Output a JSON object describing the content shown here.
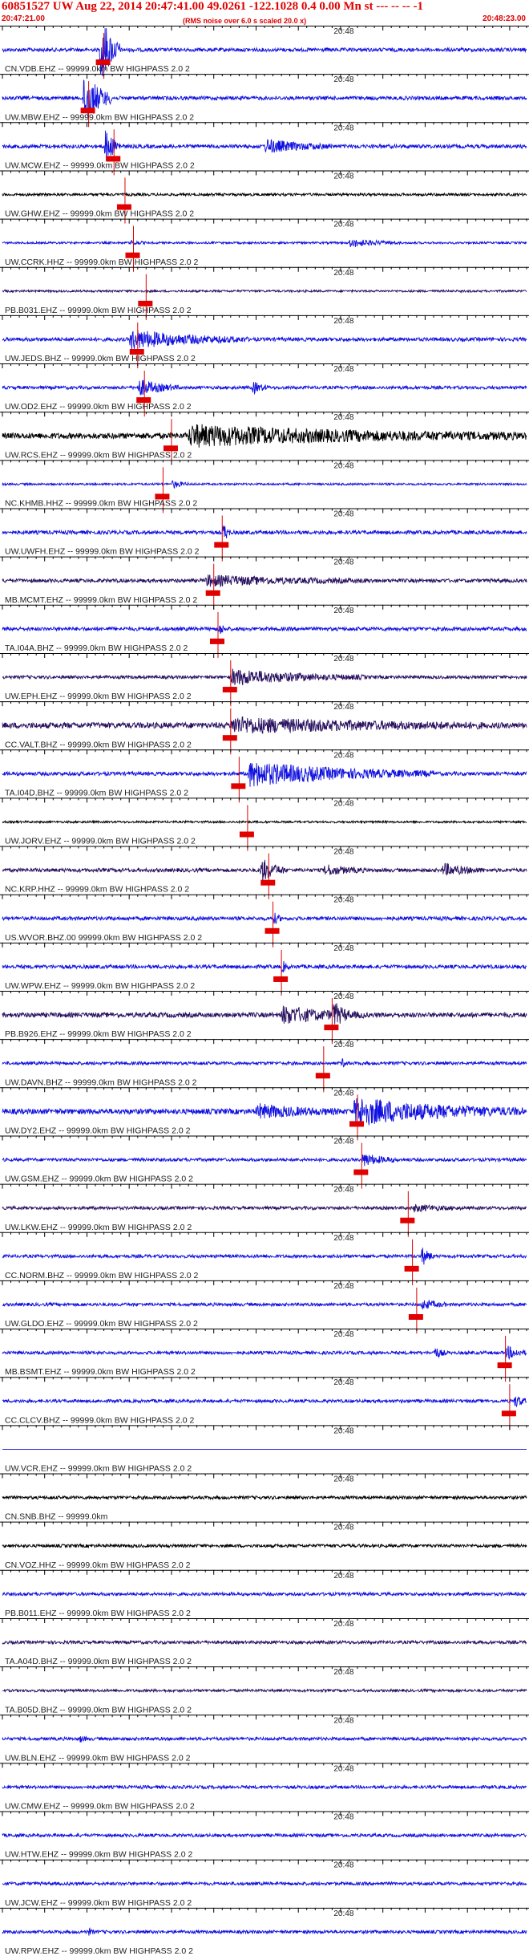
{
  "header": {
    "title": "60851527 UW Aug 22, 2014 20:47:41.00   49.0261 -122.1028  0.4 0.00 Mn st --- -- --   -1",
    "start_time": "20:47:21.00",
    "note": "(RMS noise over 6.0 s scaled 20.0 x)",
    "end_time": "20:48:23.00"
  },
  "chart_data": {
    "type": "line",
    "title": "60851527 UW Aug 22, 2014 20:47:41.00   49.0261 -122.1028  0.4 0.00 Mn st --- -- --   -1",
    "x_start": "20:47:21.00",
    "x_end": "20:48:23.00",
    "time_mark": "20:48",
    "duration_s": 62,
    "colors": {
      "blue": "#1010e0",
      "dark": "#281060",
      "black": "#000000",
      "pick": "#e00000",
      "grid": "#000000"
    },
    "traces": [
      {
        "label": "CN.VDB.EHZ -- 99999.0km BW  HIGHPASS  2.0  2",
        "color": "blue",
        "noise": 0.35,
        "pick": 12.0,
        "events": [
          {
            "t": 11.5,
            "dur": 2.5,
            "amp": 8
          }
        ]
      },
      {
        "label": "UW.MBW.EHZ -- 99999.0km BW  HIGHPASS  2.0  2",
        "color": "blue",
        "noise": 0.35,
        "pick": 10.2,
        "events": [
          {
            "t": 9.5,
            "dur": 3.5,
            "amp": 6
          }
        ]
      },
      {
        "label": "UW.MCW.EHZ -- 99999.0km BW  HIGHPASS  2.0  2",
        "color": "blue",
        "noise": 0.35,
        "pick": 13.2,
        "events": [
          {
            "t": 12.0,
            "dur": 2.0,
            "amp": 4
          },
          {
            "t": 31.0,
            "dur": 8,
            "amp": 1.3
          }
        ]
      },
      {
        "label": "UW.GHW.EHZ -- 99999.0km BW  HIGHPASS  2.0  2",
        "color": "black",
        "noise": 0.25,
        "pick": 14.5,
        "events": []
      },
      {
        "label": "UW.CCRK.HHZ -- 99999.0km BW  HIGHPASS  2.0  2",
        "color": "blue",
        "noise": 0.2,
        "pick": 15.5,
        "events": [
          {
            "t": 15.0,
            "dur": 2,
            "amp": 0.5
          },
          {
            "t": 41.0,
            "dur": 6,
            "amp": 0.8
          }
        ]
      },
      {
        "label": "PB.B031.EHZ -- 99999.0km BW  HIGHPASS  2.0  2",
        "color": "dark",
        "noise": 0.2,
        "pick": 17.0,
        "events": []
      },
      {
        "label": "UW.JEDS.BHZ -- 99999.0km BW  HIGHPASS  2.0  2",
        "color": "blue",
        "noise": 0.35,
        "pick": 16.0,
        "events": [
          {
            "t": 15.0,
            "dur": 14,
            "amp": 1.8
          }
        ]
      },
      {
        "label": "UW.OD2.EHZ -- 99999.0km BW  HIGHPASS  2.0  2",
        "color": "blue",
        "noise": 0.3,
        "pick": 16.8,
        "events": [
          {
            "t": 16.0,
            "dur": 5,
            "amp": 1.6
          },
          {
            "t": 29.5,
            "dur": 2,
            "amp": 1.3
          }
        ]
      },
      {
        "label": "UW.RCS.EHZ -- 99999.0km BW  HIGHPASS  2.0  2",
        "color": "black",
        "noise": 0.55,
        "pick": 20.0,
        "events": [
          {
            "t": 22.0,
            "dur": 40,
            "amp": 1.8
          }
        ]
      },
      {
        "label": "NC.KHMB.HHZ -- 99999.0km BW  HIGHPASS  2.0  2",
        "color": "blue",
        "noise": 0.2,
        "pick": 19.0,
        "events": [
          {
            "t": 20.0,
            "dur": 2,
            "amp": 0.9
          }
        ]
      },
      {
        "label": "UW.UWFH.EHZ -- 99999.0km BW  HIGHPASS  2.0  2",
        "color": "blue",
        "noise": 0.35,
        "pick": 26.0,
        "events": [
          {
            "t": 26.0,
            "dur": 1,
            "amp": 2.5
          }
        ]
      },
      {
        "label": "MB.MCMT.EHZ -- 99999.0km BW  HIGHPASS  2.0  2",
        "color": "dark",
        "noise": 0.35,
        "pick": 25.0,
        "events": [
          {
            "t": 24.0,
            "dur": 20,
            "amp": 0.9
          }
        ]
      },
      {
        "label": "TA.I04A.BHZ -- 99999.0km BW  HIGHPASS  2.0  2",
        "color": "blue",
        "noise": 0.35,
        "pick": 25.5,
        "events": [
          {
            "t": 25.5,
            "dur": 1,
            "amp": 1.5
          }
        ]
      },
      {
        "label": "UW.EPH.EHZ -- 99999.0km BW  HIGHPASS  2.0  2",
        "color": "dark",
        "noise": 0.3,
        "pick": 27.0,
        "events": [
          {
            "t": 27.0,
            "dur": 16,
            "amp": 1.5
          }
        ]
      },
      {
        "label": "CC.VALT.BHZ -- 99999.0km BW  HIGHPASS  2.0  2",
        "color": "dark",
        "noise": 0.55,
        "pick": 27.0,
        "events": [
          {
            "t": 27.0,
            "dur": 30,
            "amp": 1.3
          }
        ]
      },
      {
        "label": "TA.I04D.BHZ -- 99999.0km BW  HIGHPASS  2.0  2",
        "color": "blue",
        "noise": 0.35,
        "pick": 28.0,
        "events": [
          {
            "t": 29.0,
            "dur": 22,
            "amp": 2.3
          }
        ]
      },
      {
        "label": "UW.JORV.EHZ -- 99999.0km BW  HIGHPASS  2.0  2",
        "color": "black",
        "noise": 0.2,
        "pick": 29.0,
        "events": []
      },
      {
        "label": "NC.KRP.HHZ -- 99999.0km BW  HIGHPASS  2.0  2",
        "color": "dark",
        "noise": 0.35,
        "pick": 31.5,
        "events": [
          {
            "t": 30.5,
            "dur": 3,
            "amp": 2.5
          },
          {
            "t": 38.0,
            "dur": 5,
            "amp": 1.0
          },
          {
            "t": 52.0,
            "dur": 5,
            "amp": 1.2
          }
        ]
      },
      {
        "label": "US.WVOR.BHZ.00 99999.0km BW  HIGHPASS  2.0  2",
        "color": "blue",
        "noise": 0.35,
        "pick": 32.0,
        "events": [
          {
            "t": 32.0,
            "dur": 1,
            "amp": 1.4
          }
        ]
      },
      {
        "label": "UW.WPW.EHZ -- 99999.0km BW  HIGHPASS  2.0  2",
        "color": "blue",
        "noise": 0.35,
        "pick": 33.0,
        "events": [
          {
            "t": 33.0,
            "dur": 1,
            "amp": 1.4
          }
        ]
      },
      {
        "label": "PB.B926.EHZ -- 99999.0km BW  HIGHPASS  2.0  2",
        "color": "dark",
        "noise": 0.45,
        "pick": 39.0,
        "events": [
          {
            "t": 33.0,
            "dur": 10,
            "amp": 1.6
          },
          {
            "t": 39.0,
            "dur": 2,
            "amp": 2.5
          }
        ]
      },
      {
        "label": "UW.DAVN.BHZ -- 99999.0km BW  HIGHPASS  2.0  2",
        "color": "blue",
        "noise": 0.3,
        "pick": 38.0,
        "events": [
          {
            "t": 40.0,
            "dur": 1,
            "amp": 1.0
          }
        ]
      },
      {
        "label": "UW.DY2.EHZ -- 99999.0km BW  HIGHPASS  2.0  2",
        "color": "blue",
        "noise": 0.5,
        "pick": 42.0,
        "events": [
          {
            "t": 30.0,
            "dur": 10,
            "amp": 1.2
          },
          {
            "t": 41.5,
            "dur": 20,
            "amp": 2.6
          }
        ]
      },
      {
        "label": "UW.GSM.EHZ -- 99999.0km BW  HIGHPASS  2.0  2",
        "color": "blue",
        "noise": 0.3,
        "pick": 42.5,
        "events": [
          {
            "t": 42.5,
            "dur": 4,
            "amp": 1.3
          }
        ]
      },
      {
        "label": "UW.LKW.EHZ -- 99999.0km BW  HIGHPASS  2.0  2",
        "color": "dark",
        "noise": 0.3,
        "pick": 48.0,
        "events": [
          {
            "t": 48.5,
            "dur": 6,
            "amp": 0.6
          }
        ]
      },
      {
        "label": "CC.NORM.BHZ -- 99999.0km BW  HIGHPASS  2.0  2",
        "color": "blue",
        "noise": 0.3,
        "pick": 48.5,
        "events": [
          {
            "t": 49.5,
            "dur": 1.5,
            "amp": 2.2
          }
        ]
      },
      {
        "label": "UW.GLDO.EHZ -- 99999.0km BW  HIGHPASS  2.0  2",
        "color": "blue",
        "noise": 0.3,
        "pick": 49.0,
        "events": [
          {
            "t": 49.5,
            "dur": 3,
            "amp": 1.0
          }
        ]
      },
      {
        "label": "MB.BSMT.EHZ -- 99999.0km BW  HIGHPASS  2.0  2",
        "color": "blue",
        "noise": 0.3,
        "pick": 59.5,
        "events": [
          {
            "t": 51.0,
            "dur": 1.5,
            "amp": 1.3
          },
          {
            "t": 59.5,
            "dur": 2.5,
            "amp": 1.4
          }
        ]
      },
      {
        "label": "CC.CLCV.BHZ -- 99999.0km BW  HIGHPASS  2.0  2",
        "color": "blue",
        "noise": 0.3,
        "pick": 60.0,
        "events": [
          {
            "t": 60.5,
            "dur": 1.5,
            "amp": 1.5
          }
        ]
      },
      {
        "label": "UW.VCR.EHZ -- 99999.0km BW  HIGHPASS  2.0  2",
        "color": "blue",
        "noise": 0.0,
        "events": []
      },
      {
        "label": "CN.SNB.BHZ -- 99999.0km",
        "color": "black",
        "noise": 0.3,
        "events": []
      },
      {
        "label": "CN.VOZ.HHZ -- 99999.0km BW  HIGHPASS  2.0  2",
        "color": "black",
        "noise": 0.3,
        "events": []
      },
      {
        "label": "PB.B011.EHZ -- 99999.0km BW  HIGHPASS  2.0  2",
        "color": "blue",
        "noise": 0.3,
        "events": []
      },
      {
        "label": "TA.A04D.BHZ -- 99999.0km BW  HIGHPASS  2.0  2",
        "color": "dark",
        "noise": 0.3,
        "events": []
      },
      {
        "label": "TA.B05D.BHZ -- 99999.0km BW  HIGHPASS  2.0  2",
        "color": "dark",
        "noise": 0.25,
        "events": []
      },
      {
        "label": "UW.BLN.EHZ -- 99999.0km BW  HIGHPASS  2.0  2",
        "color": "blue",
        "noise": 0.3,
        "events": [
          {
            "t": 9.0,
            "dur": 1,
            "amp": 0.8
          }
        ]
      },
      {
        "label": "UW.CMW.EHZ -- 99999.0km BW  HIGHPASS  2.0  2",
        "color": "blue",
        "noise": 0.3,
        "events": []
      },
      {
        "label": "UW.HTW.EHZ -- 99999.0km BW  HIGHPASS  2.0  2",
        "color": "blue",
        "noise": 0.3,
        "events": []
      },
      {
        "label": "UW.JCW.EHZ -- 99999.0km BW  HIGHPASS  2.0  2",
        "color": "blue",
        "noise": 0.3,
        "events": []
      },
      {
        "label": "UW.RPW.EHZ -- 99999.0km BW  HIGHPASS  2.0  2",
        "color": "blue",
        "noise": 0.3,
        "events": [
          {
            "t": 10.0,
            "dur": 1,
            "amp": 0.8
          }
        ]
      }
    ]
  }
}
